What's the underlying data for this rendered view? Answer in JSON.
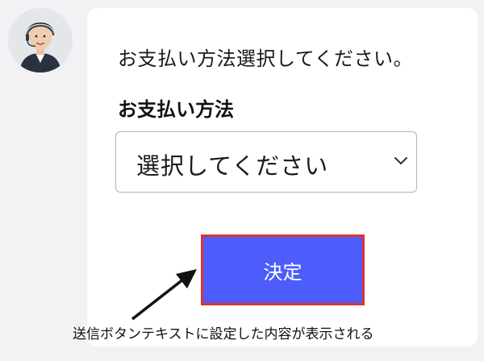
{
  "chat": {
    "message": "お支払い方法選択してください。",
    "field_label": "お支払い方法",
    "select": {
      "selected": "選択してください"
    },
    "submit_label": "決定"
  },
  "annotation": "送信ボタンテキストに設定した内容が表示される",
  "colors": {
    "submit_button": "#4c5dfb",
    "highlight_border": "#e0322a",
    "background": "#f2f2f4",
    "card": "#ffffff"
  },
  "icons": {
    "avatar": "operator-avatar",
    "select_arrow": "chevron-down-icon",
    "annotation_arrow": "arrow-icon"
  }
}
